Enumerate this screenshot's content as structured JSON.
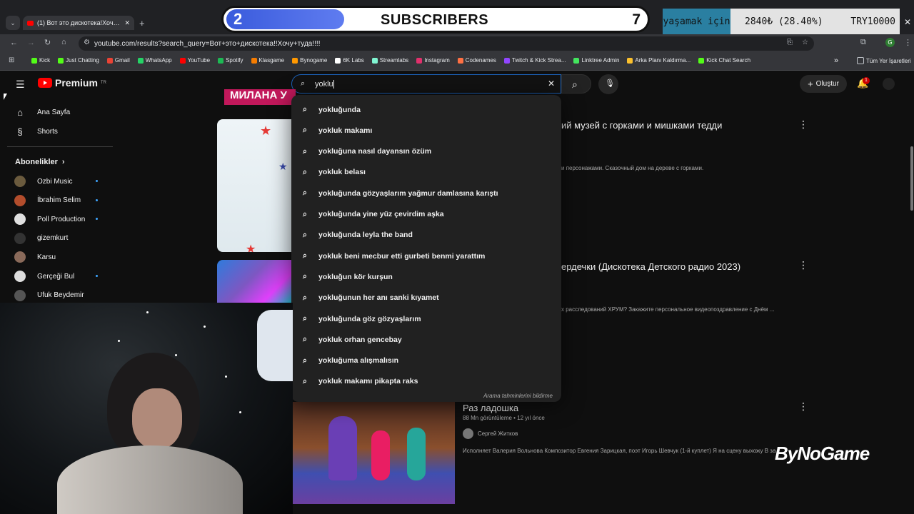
{
  "stream_overlay": {
    "subscriber_count": "2",
    "subscriber_label": "SUBSCRIBERS",
    "subscriber_goal": "7",
    "ticker": [
      "yaşamak için",
      "2840₺ (28.40%)",
      "TRY10000"
    ],
    "brand": "ByNoGame"
  },
  "browser": {
    "tab_title": "(1) Вот это дискотека!Хочу ту",
    "new_tab_glyph": "+",
    "url": "youtube.com/results?search_query=Вот+это+дискотека!!Хочу+туда!!!!",
    "profile_initial": "G",
    "bookmarks": [
      {
        "label": "Kick",
        "color": "#53fc18"
      },
      {
        "label": "Just Chatting",
        "color": "#53fc18"
      },
      {
        "label": "Gmail",
        "color": "#ea4335"
      },
      {
        "label": "WhatsApp",
        "color": "#25d366"
      },
      {
        "label": "YouTube",
        "color": "#ff0000"
      },
      {
        "label": "Spotify",
        "color": "#1db954"
      },
      {
        "label": "Klasgame",
        "color": "#f57c00"
      },
      {
        "label": "Bynogame",
        "color": "#ff9800"
      },
      {
        "label": "6K Labs",
        "color": "#ffffff"
      },
      {
        "label": "Streamlabs",
        "color": "#80f5d2"
      },
      {
        "label": "Instagram",
        "color": "#e1306c"
      },
      {
        "label": "Codenames",
        "color": "#ff7043"
      },
      {
        "label": "Twitch & Kick Strea...",
        "color": "#9146ff"
      },
      {
        "label": "Linktree Admin",
        "color": "#43e55e"
      },
      {
        "label": "Arka Planı Kaldırma...",
        "color": "#fbc02d"
      },
      {
        "label": "Kick Chat Search",
        "color": "#53fc18"
      }
    ],
    "bookmarks_more": "»",
    "all_bookmarks": "Tüm Yer İşaretleri"
  },
  "youtube": {
    "logo_text": "Premium",
    "logo_region": "TR",
    "search_value": "yoklu",
    "create_label": "Oluştur",
    "notification_count": "1",
    "sidebar": {
      "home": "Ana Sayfa",
      "shorts": "Shorts",
      "subscriptions_header": "Abonelikler",
      "channels": [
        {
          "name": "Ozbi Music",
          "color": "#6b5b3e",
          "dot": true
        },
        {
          "name": "İbrahim Selim",
          "color": "#b34d2c",
          "dot": true
        },
        {
          "name": "Poll Production",
          "color": "#e0e0e0",
          "dot": true
        },
        {
          "name": "gizemkurt",
          "color": "#333333",
          "dot": false
        },
        {
          "name": "Karsu",
          "color": "#8a6a5a",
          "dot": false
        },
        {
          "name": "Gerçeği Bul",
          "color": "#dddddd",
          "dot": true
        },
        {
          "name": "Ufuk Beydemir",
          "color": "#555555",
          "dot": false
        }
      ]
    },
    "suggestions": [
      "yokluğunda",
      "yokluk makamı",
      "yokluğuna nasıl dayansın özüm",
      "yokluk belası",
      "yokluğunda gözyaşlarım yağmur damlasına karıştı",
      "yokluğunda yine yüz çevirdim aşka",
      "yokluğunda leyla the band",
      "yokluk beni mecbur etti gurbeti benmi yarattım",
      "yokluğun kör kurşun",
      "yokluğunun her anı sanki kıyamet",
      "yokluğunda göz gözyaşlarım",
      "yokluk orhan gencebay",
      "yokluğuma alışmalısın",
      "yokluk makamı pikapta raks"
    ],
    "report_link": "Arama tahminlerini bildirme",
    "results": [
      {
        "title": "ий музей с горками и мишками тедди",
        "desc": "и персонажами. Сказочный дом на дереве с горками."
      },
      {
        "title": "ердечки (Дискотека Детского радио 2023)",
        "desc": "х расследований ХРУМ? Закажите персональное видеопоздравление с Днём ..."
      },
      {
        "title": "Раз ладошка",
        "meta": "88 Mn görüntüleme • 12 yıl önce",
        "channel": "Сергей Житков",
        "desc": "Исполняет Валерия Вольнова Композитор Евгения Зарицкая, поэт Игорь Шевчук (1-й куплет) Я на сцену выхожу В за"
      }
    ],
    "partial_banner_text": "МИЛАНА У"
  }
}
